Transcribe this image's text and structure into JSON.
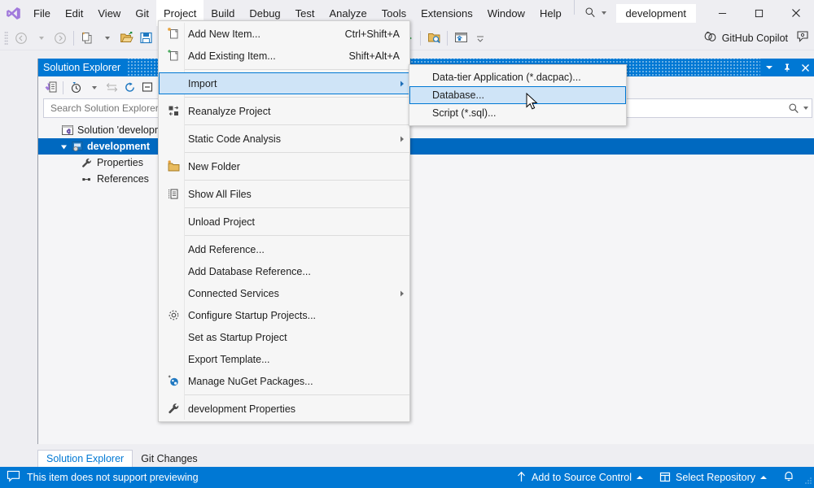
{
  "window": {
    "solution_name": "development",
    "minimize_label": "Minimize",
    "maximize_label": "Maximize",
    "close_label": "Close"
  },
  "menubar": {
    "items": [
      {
        "label": "File",
        "open": false
      },
      {
        "label": "Edit",
        "open": false
      },
      {
        "label": "View",
        "open": false
      },
      {
        "label": "Git",
        "open": false
      },
      {
        "label": "Project",
        "open": true
      },
      {
        "label": "Build",
        "open": false
      },
      {
        "label": "Debug",
        "open": false
      },
      {
        "label": "Test",
        "open": false
      },
      {
        "label": "Analyze",
        "open": false
      },
      {
        "label": "Tools",
        "open": false
      },
      {
        "label": "Extensions",
        "open": false
      },
      {
        "label": "Window",
        "open": false
      },
      {
        "label": "Help",
        "open": false
      }
    ],
    "search_icon": "search-icon"
  },
  "toolbar": {
    "copilot_label": "GitHub Copilot",
    "back_icon": "navigate-back-icon",
    "forward_icon": "navigate-forward-icon",
    "new_item_icon": "new-item-icon",
    "open_file_icon": "open-file-icon",
    "save_icon": "save-icon",
    "save_all_icon": "save-all-icon",
    "start_icon": "start-debug-icon",
    "search_solution_icon": "solution-search-icon",
    "window_layout_icon": "window-layout-icon"
  },
  "project_menu": {
    "items": [
      {
        "label": "Add New Item...",
        "shortcut": "Ctrl+Shift+A",
        "icon": "add-new-item-icon",
        "submenu": false,
        "highlight": false,
        "separator_after": false
      },
      {
        "label": "Add Existing Item...",
        "shortcut": "Shift+Alt+A",
        "icon": "add-existing-item-icon",
        "submenu": false,
        "highlight": false,
        "separator_after": true
      },
      {
        "label": "Import",
        "shortcut": "",
        "icon": "",
        "submenu": true,
        "highlight": true,
        "separator_after": true
      },
      {
        "label": "Reanalyze Project",
        "shortcut": "",
        "icon": "reanalyze-icon",
        "submenu": false,
        "highlight": false,
        "separator_after": true
      },
      {
        "label": "Static Code Analysis",
        "shortcut": "",
        "icon": "",
        "submenu": true,
        "highlight": false,
        "separator_after": true
      },
      {
        "label": "New Folder",
        "shortcut": "",
        "icon": "new-folder-icon",
        "submenu": false,
        "highlight": false,
        "separator_after": true
      },
      {
        "label": "Show All Files",
        "shortcut": "",
        "icon": "show-all-files-icon",
        "submenu": false,
        "highlight": false,
        "separator_after": true
      },
      {
        "label": "Unload Project",
        "shortcut": "",
        "icon": "",
        "submenu": false,
        "highlight": false,
        "separator_after": true
      },
      {
        "label": "Add Reference...",
        "shortcut": "",
        "icon": "",
        "submenu": false,
        "highlight": false,
        "separator_after": false
      },
      {
        "label": "Add Database Reference...",
        "shortcut": "",
        "icon": "",
        "submenu": false,
        "highlight": false,
        "separator_after": false
      },
      {
        "label": "Connected Services",
        "shortcut": "",
        "icon": "",
        "submenu": true,
        "highlight": false,
        "separator_after": false
      },
      {
        "label": "Configure Startup Projects...",
        "shortcut": "",
        "icon": "gear-icon",
        "submenu": false,
        "highlight": false,
        "separator_after": false
      },
      {
        "label": "Set as Startup Project",
        "shortcut": "",
        "icon": "",
        "submenu": false,
        "highlight": false,
        "separator_after": false
      },
      {
        "label": "Export Template...",
        "shortcut": "",
        "icon": "",
        "submenu": false,
        "highlight": false,
        "separator_after": false
      },
      {
        "label": "Manage NuGet Packages...",
        "shortcut": "",
        "icon": "nuget-icon",
        "submenu": false,
        "highlight": false,
        "separator_after": true
      },
      {
        "label": "development Properties",
        "shortcut": "",
        "icon": "wrench-icon",
        "submenu": false,
        "highlight": false,
        "separator_after": false
      }
    ]
  },
  "import_submenu": {
    "items": [
      {
        "label": "Data-tier Application (*.dacpac)...",
        "highlight": false
      },
      {
        "label": "Database...",
        "highlight": true
      },
      {
        "label": "Script (*.sql)...",
        "highlight": false
      }
    ]
  },
  "solution_explorer": {
    "title": "Solution Explorer",
    "dropdown_icon": "chevron-down-icon",
    "pin_icon": "pin-icon",
    "close_icon": "close-icon",
    "toolbar_icons": [
      "solution-switcher-icon",
      "pending-changes-filter-icon",
      "sync-with-active-document-icon",
      "refresh-icon",
      "collapse-all-icon",
      "show-all-files-icon",
      "properties-icon",
      "preview-selected-items-icon"
    ],
    "search_placeholder": "Search Solution Explorer (Ctrl+;)",
    "search_value": "",
    "search_icon": "search-icon",
    "tree": [
      {
        "label": "Solution 'development' (1 of 1 project)",
        "icon": "solution-icon",
        "indent": 0,
        "twisty": "none",
        "selected": false,
        "bold": false
      },
      {
        "label": "development",
        "icon": "project-icon",
        "indent": 1,
        "twisty": "expanded",
        "selected": true,
        "bold": true
      },
      {
        "label": "Properties",
        "icon": "wrench-icon",
        "indent": 2,
        "twisty": "none",
        "selected": false,
        "bold": false
      },
      {
        "label": "References",
        "icon": "references-icon",
        "indent": 2,
        "twisty": "none",
        "selected": false,
        "bold": false
      }
    ]
  },
  "bottom_tabs": {
    "items": [
      {
        "label": "Solution Explorer",
        "active": true
      },
      {
        "label": "Git Changes",
        "active": false
      }
    ]
  },
  "statusbar": {
    "message": "This item does not support previewing",
    "message_icon": "callout-icon",
    "add_to_source_control": "Add to Source Control",
    "add_to_source_control_icon": "arrow-up-icon",
    "select_repository": "Select Repository",
    "select_repository_icon": "repository-icon",
    "notifications_icon": "bell-icon"
  },
  "colors": {
    "accent_blue": "#0078d4",
    "selection_blue": "#0069c0",
    "menu_highlight": "#cfe4f7",
    "chrome_bg": "#eeeef2",
    "panel_bg": "#f5f5f7"
  }
}
